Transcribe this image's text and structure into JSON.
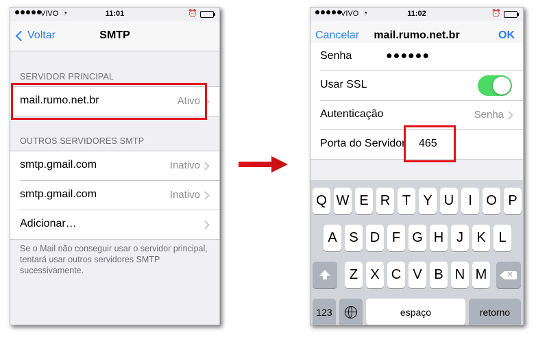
{
  "left_phone": {
    "status": {
      "carrier": "VIVO",
      "time": "11:01"
    },
    "nav": {
      "back_label": "Voltar",
      "title": "SMTP"
    },
    "primary_header": "SERVIDOR PRINCIPAL",
    "primary_server": {
      "host": "mail.rumo.net.br",
      "status": "Ativo"
    },
    "other_header": "OUTROS SERVIDORES SMTP",
    "other_servers": [
      {
        "host": "smtp.gmail.com",
        "status": "Inativo"
      },
      {
        "host": "smtp.gmail.com",
        "status": "Inativo"
      }
    ],
    "add_label": "Adicionar…",
    "footer": "Se o Mail não conseguir usar o servidor principal, tentará usar outros servidores SMTP sucessivamente."
  },
  "right_phone": {
    "status": {
      "carrier": "VIVO",
      "time": "11:02"
    },
    "nav": {
      "cancel_label": "Cancelar",
      "title": "mail.rumo.net.br",
      "ok_label": "OK"
    },
    "rows": {
      "password_label": "Senha",
      "password_value": "●●●●●●",
      "ssl_label": "Usar SSL",
      "ssl_enabled": true,
      "auth_label": "Autenticação",
      "auth_value": "Senha",
      "port_label": "Porta do Servidor",
      "port_value": "465"
    },
    "keyboard": {
      "row1": [
        "Q",
        "W",
        "E",
        "R",
        "T",
        "Y",
        "U",
        "I",
        "O",
        "P"
      ],
      "row2": [
        "A",
        "S",
        "D",
        "F",
        "G",
        "H",
        "J",
        "K",
        "L"
      ],
      "row3": [
        "Z",
        "X",
        "C",
        "V",
        "B",
        "N",
        "M"
      ],
      "numbers_label": "123",
      "space_label": "espaço",
      "return_label": "retorno"
    }
  },
  "colors": {
    "ios_blue": "#2a7ef3",
    "highlight_red": "#e1141a",
    "toggle_green": "#4cd964"
  }
}
